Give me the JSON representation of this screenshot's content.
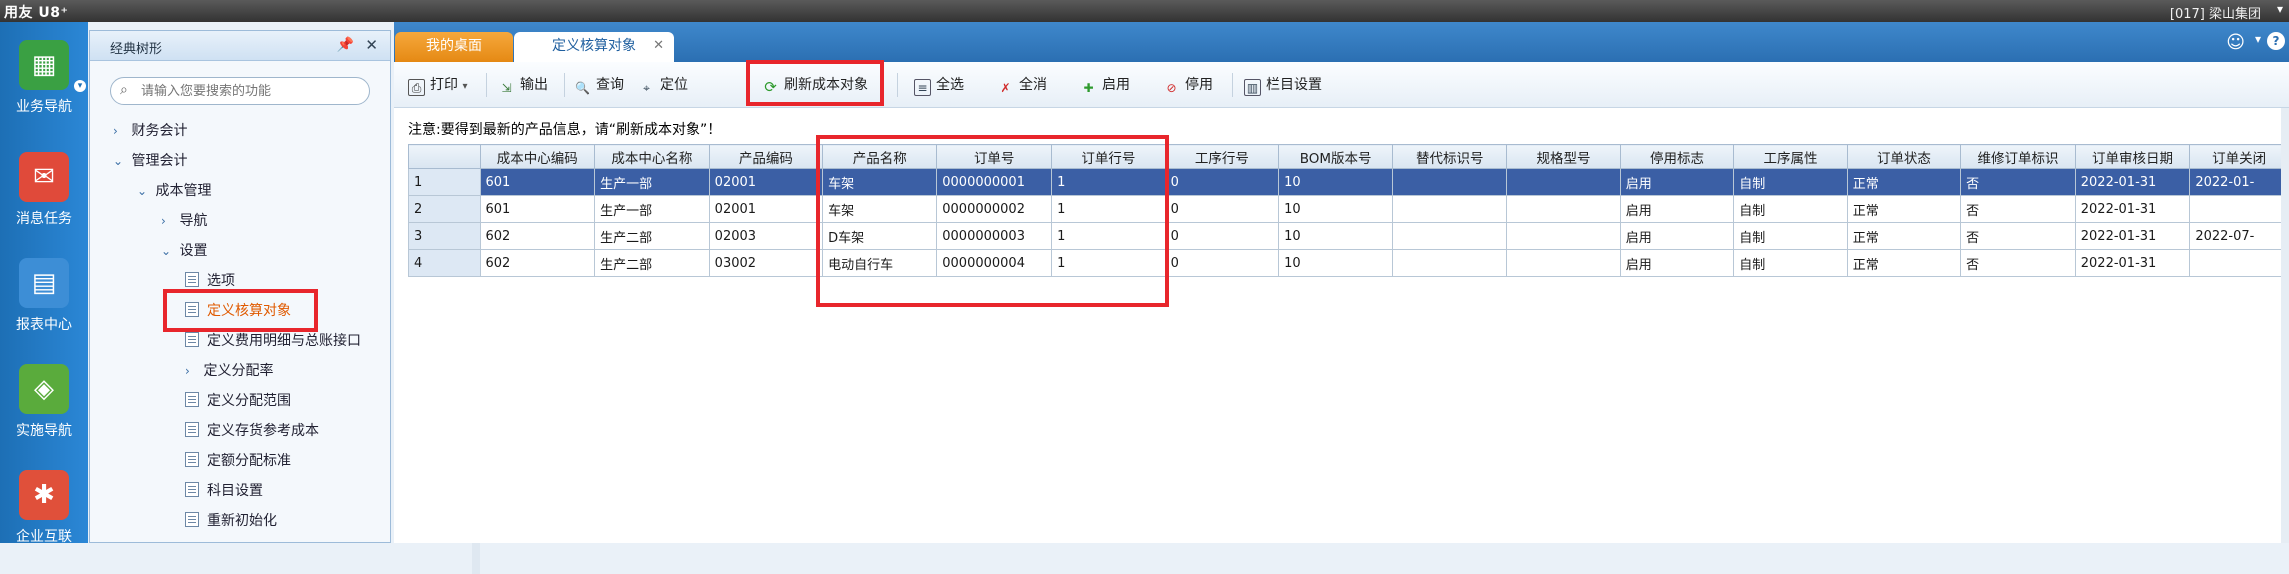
{
  "app": {
    "title": "用友 U8⁺",
    "company": "[017] 梁山集团"
  },
  "rail": [
    {
      "label": "业务导航",
      "icon": "business-nav-icon",
      "color": "#3aa043"
    },
    {
      "label": "消息任务",
      "icon": "message-icon",
      "color": "#e04a3a"
    },
    {
      "label": "报表中心",
      "icon": "report-icon",
      "color": "#3d8ed6"
    },
    {
      "label": "实施导航",
      "icon": "compass-icon",
      "color": "#5aab3c"
    },
    {
      "label": "企业互联",
      "icon": "enterprise-icon",
      "color": "#e0503a"
    }
  ],
  "tree": {
    "title": "经典树形",
    "search_placeholder": "请输入您要搜索的功能",
    "nodes": [
      "财务会计",
      "管理会计",
      "成本管理",
      "导航",
      "设置",
      "选项",
      "定义核算对象",
      "定义费用明细与总账接口",
      "定义分配率",
      "定义分配范围",
      "定义存货参考成本",
      "定额分配标准",
      "科目设置",
      "重新初始化"
    ]
  },
  "tabs": {
    "desktop": "我的桌面",
    "active": "定义核算对象"
  },
  "toolbar": {
    "print": "打印",
    "export": "输出",
    "query": "查询",
    "locate": "定位",
    "refresh": "刷新成本对象",
    "select_all": "全选",
    "deselect_all": "全消",
    "enable": "启用",
    "disable": "停用",
    "column_settings": "栏目设置"
  },
  "notice": "注意:要得到最新的产品信息，请“刷新成本对象”！",
  "grid": {
    "columns": [
      "",
      "成本中心编码",
      "成本中心名称",
      "产品编码",
      "产品名称",
      "订单号",
      "订单行号",
      "工序行号",
      "BOM版本号",
      "替代标识号",
      "规格型号",
      "停用标志",
      "工序属性",
      "订单状态",
      "维修订单标识",
      "订单审核日期",
      "订单关闭"
    ],
    "rows": [
      [
        "1",
        "601",
        "生产一部",
        "02001",
        "车架",
        "0000000001",
        "1",
        "0",
        "10",
        "",
        "",
        "启用",
        "自制",
        "正常",
        "否",
        "2022-01-31",
        "2022-01-"
      ],
      [
        "2",
        "601",
        "生产一部",
        "02001",
        "车架",
        "0000000002",
        "1",
        "0",
        "10",
        "",
        "",
        "启用",
        "自制",
        "正常",
        "否",
        "2022-01-31",
        ""
      ],
      [
        "3",
        "602",
        "生产二部",
        "02003",
        "D车架",
        "0000000003",
        "1",
        "0",
        "10",
        "",
        "",
        "启用",
        "自制",
        "正常",
        "否",
        "2022-01-31",
        "2022-07-"
      ],
      [
        "4",
        "602",
        "生产二部",
        "03002",
        "电动自行车",
        "0000000004",
        "1",
        "0",
        "10",
        "",
        "",
        "启用",
        "自制",
        "正常",
        "否",
        "2022-01-31",
        ""
      ]
    ],
    "selected_row": 0
  }
}
